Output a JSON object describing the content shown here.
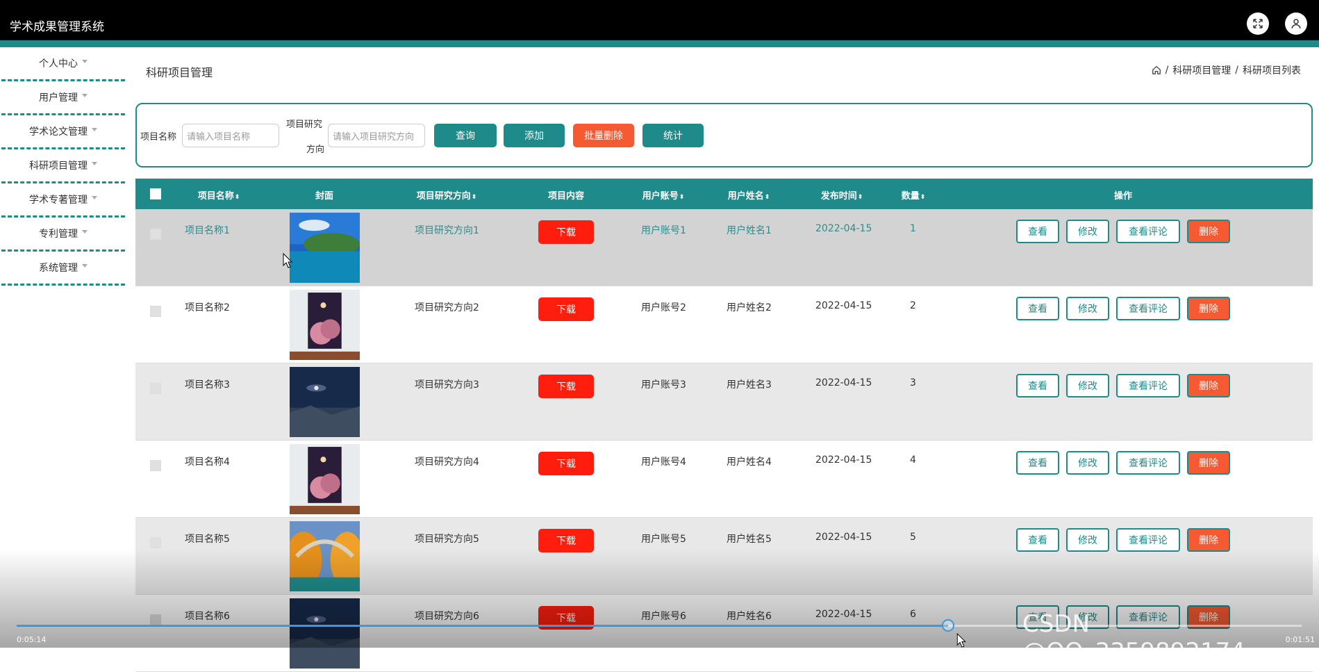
{
  "header": {
    "app_title": "学术成果管理系统",
    "fullscreen_icon": "fullscreen-icon",
    "user_icon": "user-icon"
  },
  "sidebar": {
    "items": [
      {
        "label": "个人中心"
      },
      {
        "label": "用户管理"
      },
      {
        "label": "学术论文管理"
      },
      {
        "label": "科研项目管理"
      },
      {
        "label": "学术专著管理"
      },
      {
        "label": "专利管理"
      },
      {
        "label": "系统管理"
      }
    ]
  },
  "page": {
    "title": "科研项目管理"
  },
  "breadcrumb": {
    "home_icon": "home-icon",
    "separator": "/",
    "level1": "科研项目管理",
    "level2": "科研项目列表"
  },
  "filter": {
    "name_label": "项目名称",
    "name_placeholder": "请输入项目名称",
    "direction_label_line1": "项目研究",
    "direction_label_line2": "方向",
    "direction_placeholder": "请输入项目研究方向",
    "query_btn": "查询",
    "add_btn": "添加",
    "batch_delete_btn": "批量删除",
    "stats_btn": "统计"
  },
  "table": {
    "headers": {
      "name": "项目名称",
      "cover": "封面",
      "direction": "项目研究方向",
      "content": "项目内容",
      "account": "用户账号",
      "username": "用户姓名",
      "date": "发布时间",
      "qty": "数量",
      "ops": "操作"
    },
    "sort_glyph": "⬍",
    "download_label": "下载",
    "ops": {
      "view": "查看",
      "edit": "修改",
      "comments": "查看评论",
      "delete": "删除"
    },
    "rows": [
      {
        "name": "项目名称1",
        "direction": "项目研究方向1",
        "account": "用户账号1",
        "username": "用户姓名1",
        "date": "2022-04-15",
        "qty": "1",
        "cover": "island-sea"
      },
      {
        "name": "项目名称2",
        "direction": "项目研究方向2",
        "account": "用户账号2",
        "username": "用户姓名2",
        "date": "2022-04-15",
        "qty": "2",
        "cover": "pink-clouds"
      },
      {
        "name": "项目名称3",
        "direction": "项目研究方向3",
        "account": "用户账号3",
        "username": "用户姓名3",
        "date": "2022-04-15",
        "qty": "3",
        "cover": "night-sky"
      },
      {
        "name": "项目名称4",
        "direction": "项目研究方向4",
        "account": "用户账号4",
        "username": "用户姓名4",
        "date": "2022-04-15",
        "qty": "4",
        "cover": "pink-clouds"
      },
      {
        "name": "项目名称5",
        "direction": "项目研究方向5",
        "account": "用户账号5",
        "username": "用户姓名5",
        "date": "2022-04-15",
        "qty": "5",
        "cover": "autumn-bridge"
      },
      {
        "name": "项目名称6",
        "direction": "项目研究方向6",
        "account": "用户账号6",
        "username": "用户姓名6",
        "date": "2022-04-15",
        "qty": "6",
        "cover": "night-sky"
      }
    ]
  },
  "player": {
    "elapsed": "0:05:14",
    "remaining": "0:01:51",
    "progress": 0.725
  },
  "watermark": "CSDN @QQ_3359892174",
  "colors": {
    "teal": "#1f8a8a",
    "orange": "#f55a32",
    "download_red": "#ff1e0e",
    "progress_blue": "#3a98e0"
  }
}
